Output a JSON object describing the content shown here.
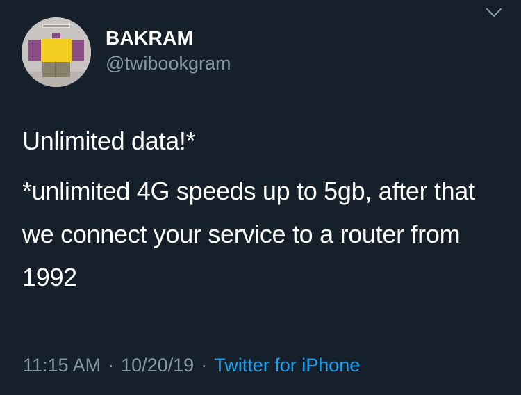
{
  "user": {
    "display_name": "BAKRAM",
    "handle": "@twibookgram"
  },
  "tweet": {
    "line1": "Unlimited data!*",
    "line2": "*unlimited 4G speeds up to 5gb, after that we connect your service to a router from 1992"
  },
  "meta": {
    "time": "11:15 AM",
    "date": "10/20/19",
    "separator": "·",
    "source": "Twitter for iPhone"
  },
  "icons": {
    "menu": "chevron-down-icon"
  },
  "colors": {
    "background": "#15202b",
    "text": "#ffffff",
    "secondary": "#8899a6",
    "link": "#1da1f2"
  }
}
